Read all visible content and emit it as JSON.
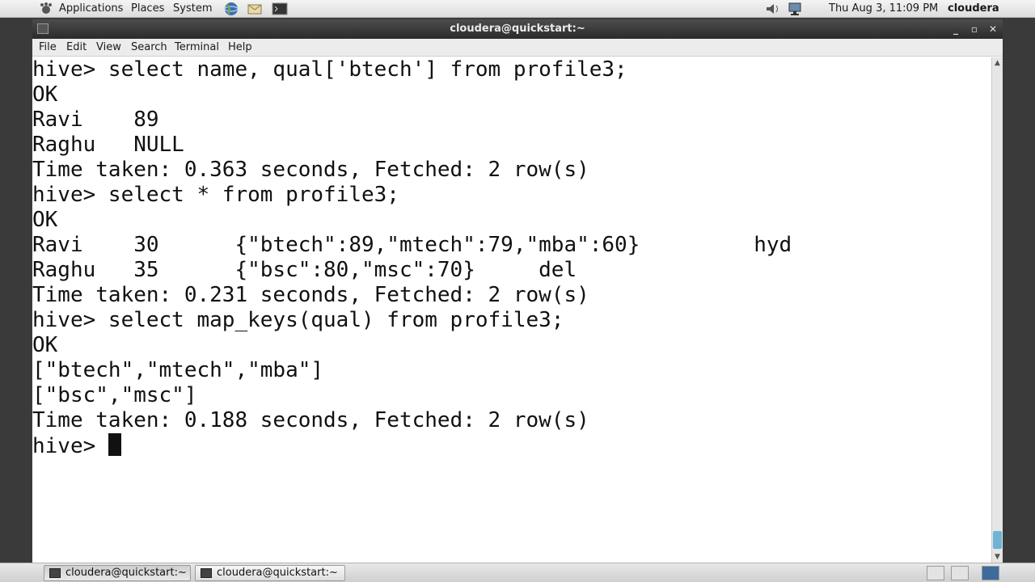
{
  "top_panel": {
    "menus": [
      "Applications",
      "Places",
      "System"
    ],
    "clock": "Thu Aug  3, 11:09 PM",
    "user": "cloudera"
  },
  "window": {
    "title": "cloudera@quickstart:~",
    "menu": [
      "File",
      "Edit",
      "View",
      "Search",
      "Terminal",
      "Help"
    ]
  },
  "terminal": {
    "lines": [
      "hive> select name, qual['btech'] from profile3;",
      "OK",
      "Ravi    89",
      "Raghu   NULL",
      "Time taken: 0.363 seconds, Fetched: 2 row(s)",
      "hive> select * from profile3;",
      "OK",
      "Ravi    30      {\"btech\":89,\"mtech\":79,\"mba\":60}         hyd",
      "Raghu   35      {\"bsc\":80,\"msc\":70}     del",
      "Time taken: 0.231 seconds, Fetched: 2 row(s)",
      "hive> select map_keys(qual) from profile3;",
      "OK",
      "[\"btech\",\"mtech\",\"mba\"]",
      "[\"bsc\",\"msc\"]",
      "Time taken: 0.188 seconds, Fetched: 2 row(s)"
    ],
    "prompt": "hive> "
  },
  "taskbar": {
    "tasks": [
      "cloudera@quickstart:~",
      "cloudera@quickstart:~"
    ]
  },
  "colors": {
    "titlebar": "#3a3a3a",
    "scroll_thumb": "#6fb3d6"
  }
}
